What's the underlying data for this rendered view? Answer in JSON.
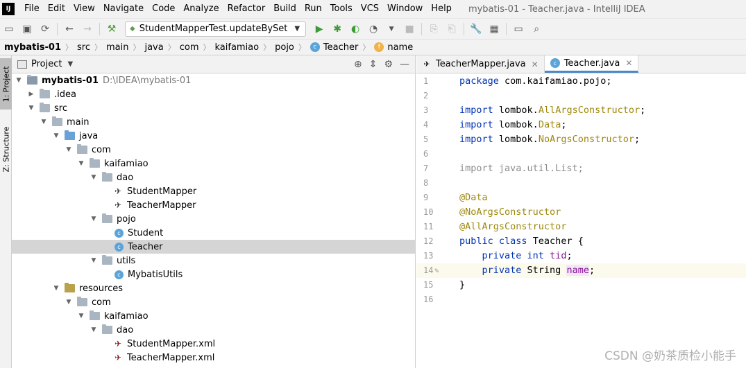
{
  "window": {
    "title": "mybatis-01 - Teacher.java - IntelliJ IDEA",
    "logo_text": "IJ"
  },
  "menu": [
    "File",
    "Edit",
    "View",
    "Navigate",
    "Code",
    "Analyze",
    "Refactor",
    "Build",
    "Run",
    "Tools",
    "VCS",
    "Window",
    "Help"
  ],
  "toolbar": {
    "run_config": "StudentMapperTest.updateBySet"
  },
  "breadcrumb": [
    "mybatis-01",
    "src",
    "main",
    "java",
    "com",
    "kaifamiao",
    "pojo",
    "Teacher",
    "name"
  ],
  "side_stripe": {
    "project_tab": "1: Project",
    "structure_tab": "Z: Structure"
  },
  "project_panel": {
    "title": "Project",
    "tree": [
      {
        "label": "mybatis-01",
        "path": "D:\\IDEA\\mybatis-01",
        "expanded": true,
        "type": "module"
      },
      {
        "label": ".idea",
        "expanded": false,
        "type": "folder"
      },
      {
        "label": "src",
        "expanded": true,
        "type": "folder"
      },
      {
        "label": "main",
        "expanded": true,
        "type": "folder"
      },
      {
        "label": "java",
        "expanded": true,
        "type": "source"
      },
      {
        "label": "com",
        "expanded": true,
        "type": "package"
      },
      {
        "label": "kaifamiao",
        "expanded": true,
        "type": "package"
      },
      {
        "label": "dao",
        "expanded": true,
        "type": "package"
      },
      {
        "label": "StudentMapper",
        "type": "mapper"
      },
      {
        "label": "TeacherMapper",
        "type": "mapper"
      },
      {
        "label": "pojo",
        "expanded": true,
        "type": "package"
      },
      {
        "label": "Student",
        "type": "class"
      },
      {
        "label": "Teacher",
        "type": "class",
        "selected": true
      },
      {
        "label": "utils",
        "expanded": true,
        "type": "package"
      },
      {
        "label": "MybatisUtils",
        "type": "class"
      },
      {
        "label": "resources",
        "expanded": true,
        "type": "resources"
      },
      {
        "label": "com",
        "expanded": true,
        "type": "package"
      },
      {
        "label": "kaifamiao",
        "expanded": true,
        "type": "package"
      },
      {
        "label": "dao",
        "expanded": true,
        "type": "package"
      },
      {
        "label": "StudentMapper.xml",
        "type": "xml"
      },
      {
        "label": "TeacherMapper.xml",
        "type": "xml"
      }
    ]
  },
  "editor": {
    "tabs": [
      {
        "label": "TeacherMapper.java",
        "active": false
      },
      {
        "label": "Teacher.java",
        "active": true
      }
    ],
    "current_line": 14,
    "lines": [
      "1",
      "2",
      "3",
      "4",
      "5",
      "6",
      "7",
      "8",
      "9",
      "10",
      "11",
      "12",
      "13",
      "14",
      "15",
      "16"
    ],
    "code": {
      "l1_kw": "package",
      "l1_rest": " com.kaifamiao.pojo;",
      "l3_kw": "import",
      "l3_pkg": " lombok.",
      "l3_ann": "AllArgsConstructor",
      "l3_end": ";",
      "l4_kw": "import",
      "l4_pkg": " lombok.",
      "l4_ann": "Data",
      "l4_end": ";",
      "l5_kw": "import",
      "l5_pkg": " lombok.",
      "l5_ann": "NoArgsConstructor",
      "l5_end": ";",
      "l7_text": "import java.util.List;",
      "l9_ann": "@Data",
      "l10_ann": "@NoArgsConstructor",
      "l11_ann": "@AllArgsConstructor",
      "l12_kw": "public class",
      "l12_rest": " Teacher {",
      "l13_kw": "    private int",
      "l13_sp": " ",
      "l13_fld": "tid",
      "l13_end": ";",
      "l14_kw": "    private",
      "l14_type": " String ",
      "l14_fld": "name",
      "l14_end": ";",
      "l15_text": "}"
    }
  },
  "watermark": "CSDN @奶茶质检小能手"
}
